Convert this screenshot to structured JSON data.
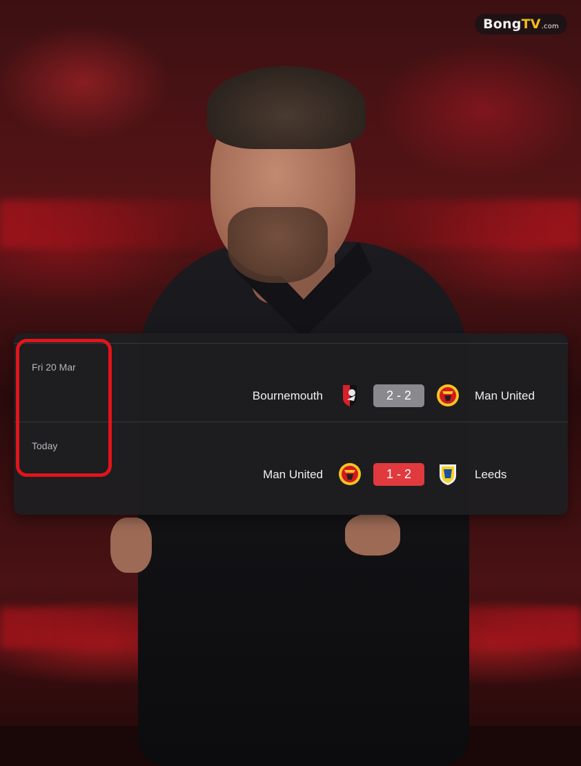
{
  "watermark": {
    "brand_main": "Bong",
    "brand_accent": "TV",
    "brand_suffix": ".com",
    "accent_color": "#f5b91a"
  },
  "results": [
    {
      "date": "Fri 20 Mar",
      "home_team": "Bournemouth",
      "home_crest": "bournemouth-crest-icon",
      "score": "2 - 2",
      "score_color": "#8a8a8e",
      "away_team": "Man United",
      "away_crest": "man-united-crest-icon"
    },
    {
      "date": "Today",
      "home_team": "Man United",
      "home_crest": "man-united-crest-icon",
      "score": "1 - 2",
      "score_color": "#e03a3e",
      "away_team": "Leeds",
      "away_crest": "leeds-crest-icon"
    }
  ],
  "highlight_color": "#e1141b"
}
